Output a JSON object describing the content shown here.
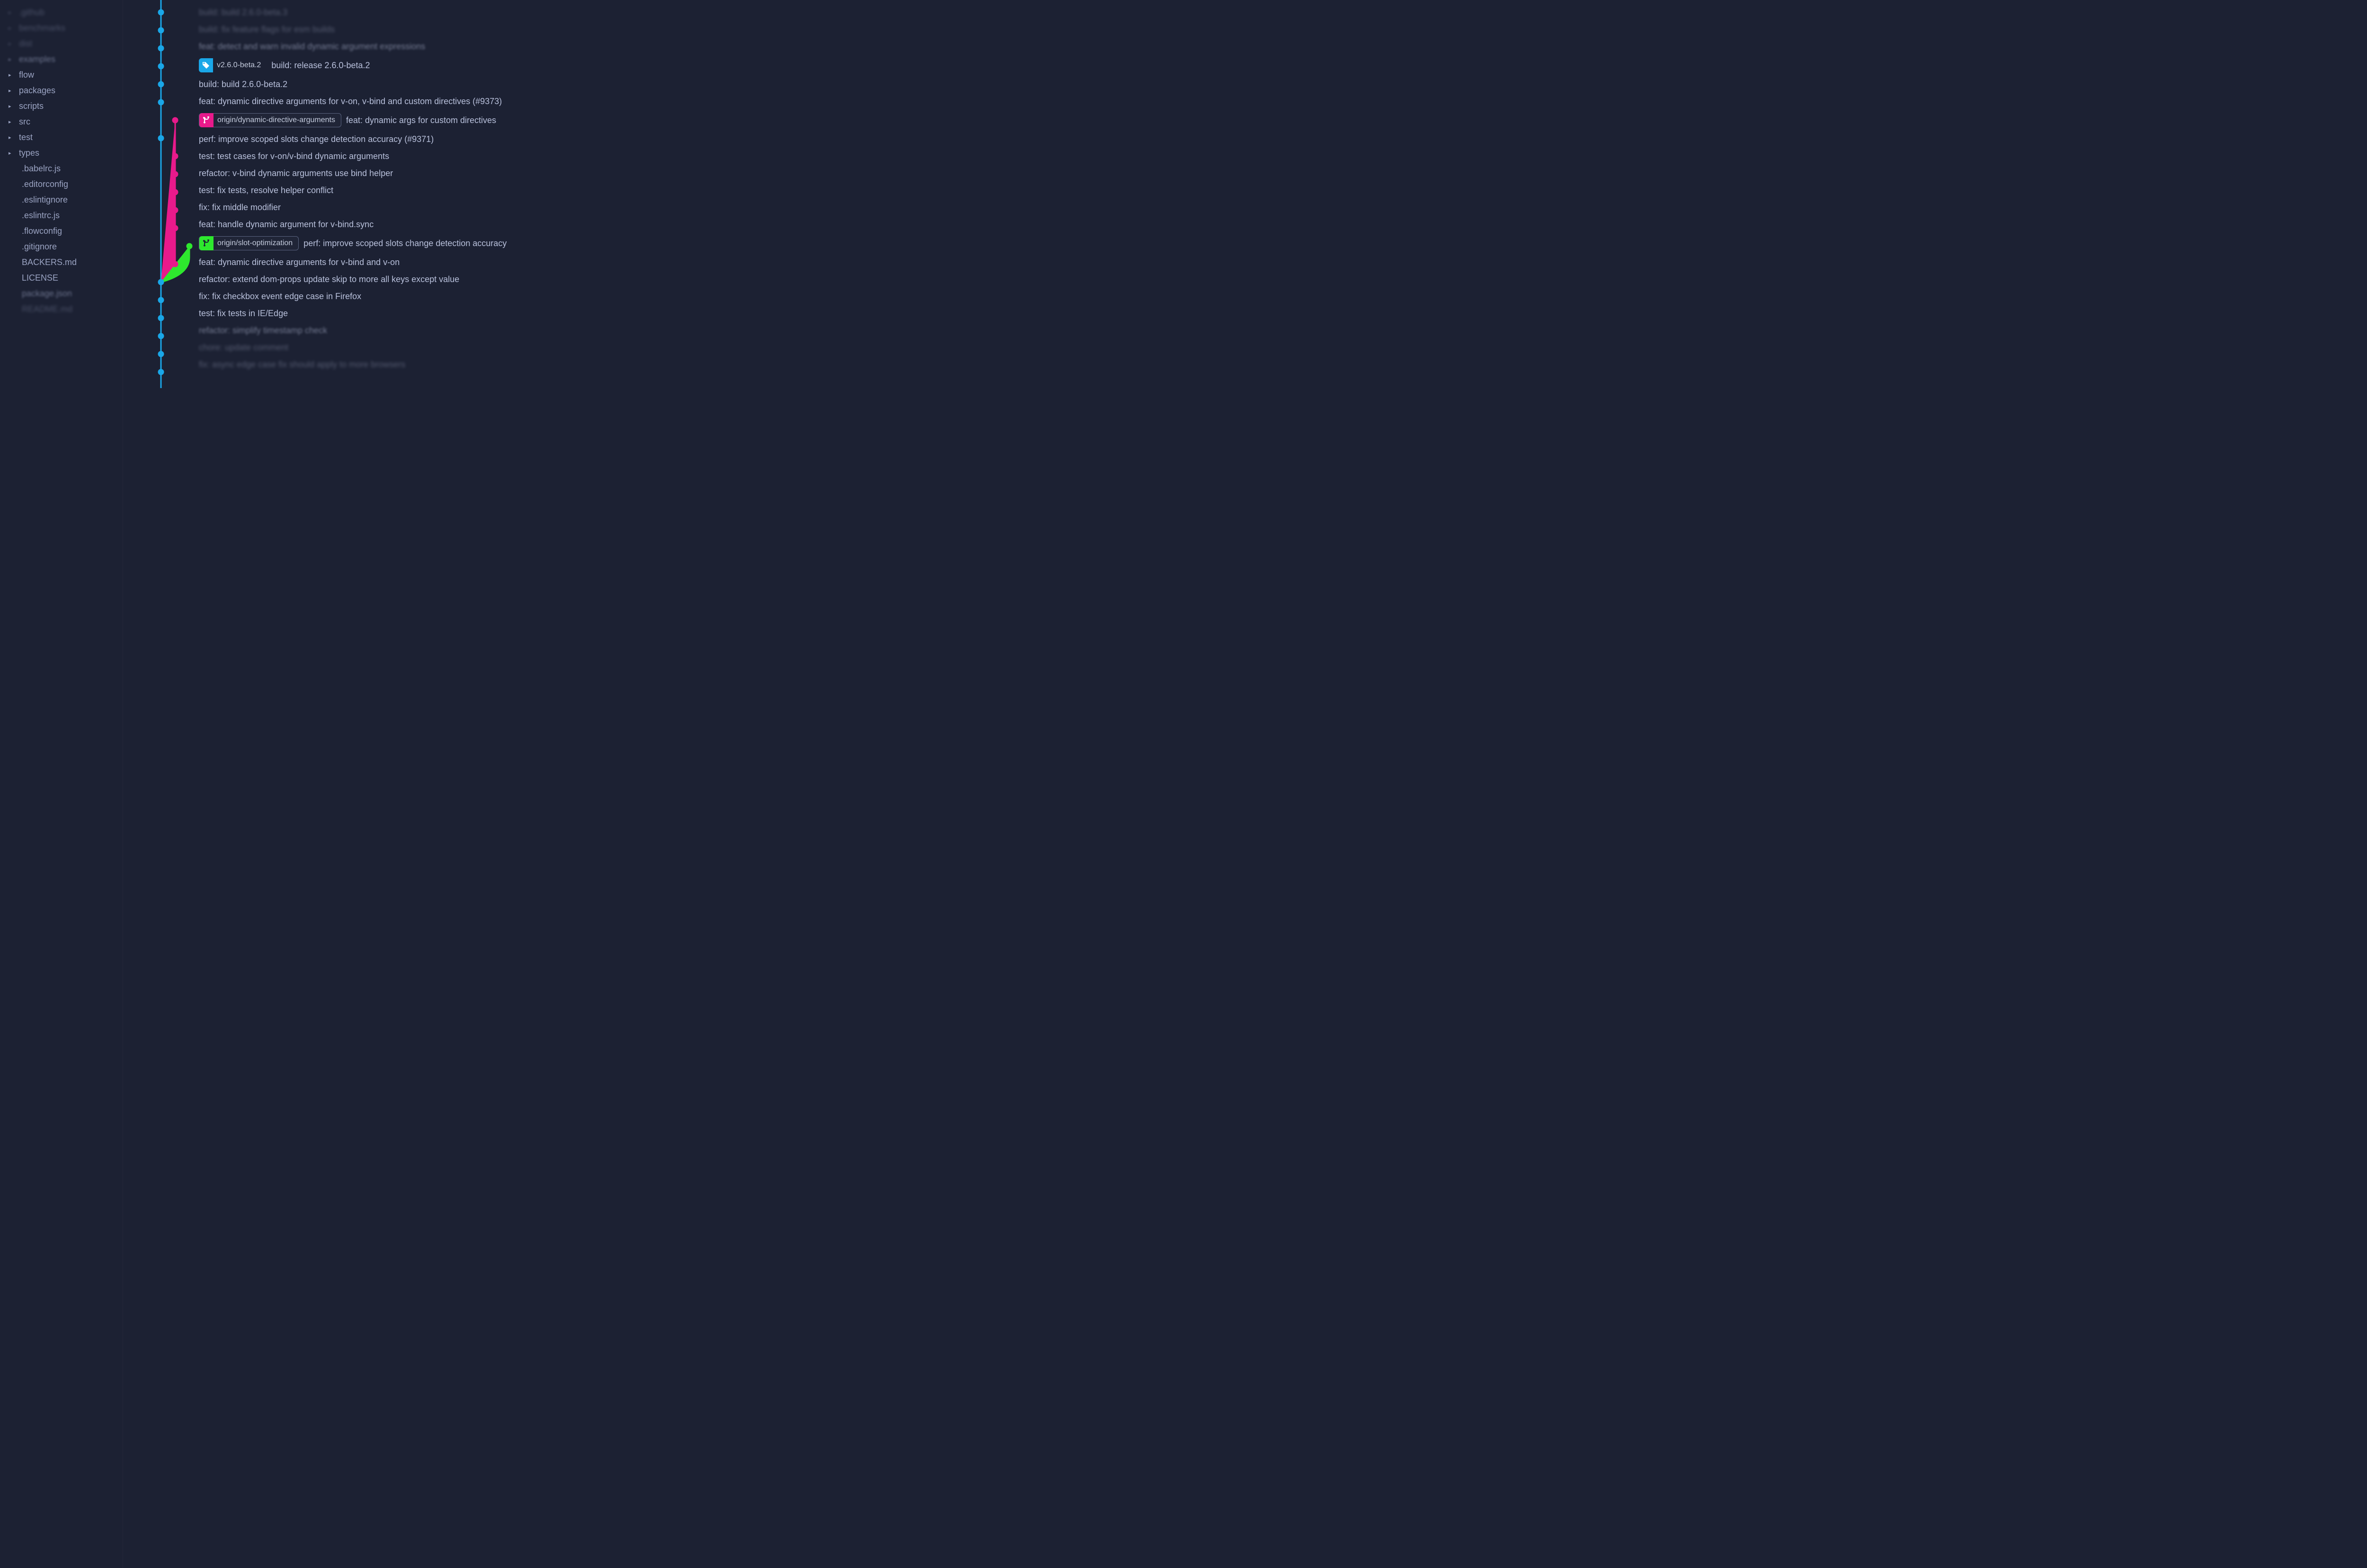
{
  "colors": {
    "bg": "#1c2133",
    "text": "#9aa3c2",
    "blue": "#1aa7e8",
    "pink": "#e81a8b",
    "green": "#2ee82e"
  },
  "sidebar": {
    "items": [
      {
        "label": ".github",
        "kind": "folder",
        "blur": "more"
      },
      {
        "label": "benchmarks",
        "kind": "folder",
        "blur": "more"
      },
      {
        "label": "dist",
        "kind": "folder",
        "blur": "more"
      },
      {
        "label": "examples",
        "kind": "folder",
        "blur": "some"
      },
      {
        "label": "flow",
        "kind": "folder",
        "blur": "none"
      },
      {
        "label": "packages",
        "kind": "folder",
        "blur": "none"
      },
      {
        "label": "scripts",
        "kind": "folder",
        "blur": "none"
      },
      {
        "label": "src",
        "kind": "folder",
        "blur": "none"
      },
      {
        "label": "test",
        "kind": "folder",
        "blur": "none"
      },
      {
        "label": "types",
        "kind": "folder",
        "blur": "none"
      },
      {
        "label": ".babelrc.js",
        "kind": "file",
        "blur": "none"
      },
      {
        "label": ".editorconfig",
        "kind": "file",
        "blur": "none"
      },
      {
        "label": ".eslintignore",
        "kind": "file",
        "blur": "none"
      },
      {
        "label": ".eslintrc.js",
        "kind": "file",
        "blur": "none"
      },
      {
        "label": ".flowconfig",
        "kind": "file",
        "blur": "none"
      },
      {
        "label": ".gitignore",
        "kind": "file",
        "blur": "none"
      },
      {
        "label": "BACKERS.md",
        "kind": "file",
        "blur": "none"
      },
      {
        "label": "LICENSE",
        "kind": "file",
        "blur": "none"
      },
      {
        "label": "package.json",
        "kind": "file",
        "blur": "some"
      },
      {
        "label": "README.md",
        "kind": "file",
        "blur": "more"
      }
    ]
  },
  "commits": [
    {
      "message": "build: build 2.6.0-beta.3",
      "blur": "more",
      "lane": "blue"
    },
    {
      "message": "build: fix feature flags for esm builds",
      "blur": "more",
      "lane": "blue"
    },
    {
      "message": "feat: detect and warn invalid dynamic argument expressions",
      "blur": "some",
      "lane": "blue"
    },
    {
      "message": "build: release 2.6.0-beta.2",
      "tag": "v2.6.0-beta.2",
      "blur": "none",
      "lane": "blue"
    },
    {
      "message": "build: build 2.6.0-beta.2",
      "blur": "none",
      "lane": "blue"
    },
    {
      "message": "feat: dynamic directive arguments for v-on, v-bind and custom directives (#9373)",
      "blur": "none",
      "lane": "blue"
    },
    {
      "message": "feat: dynamic args for custom directives",
      "branch": {
        "name": "origin/dynamic-directive-arguments",
        "color": "pink"
      },
      "blur": "none",
      "lane": "pink"
    },
    {
      "message": "perf: improve scoped slots change detection accuracy (#9371)",
      "blur": "none",
      "lane": "blue"
    },
    {
      "message": "test: test cases for v-on/v-bind dynamic arguments",
      "blur": "none",
      "lane": "pink"
    },
    {
      "message": "refactor: v-bind dynamic arguments use bind helper",
      "blur": "none",
      "lane": "pink"
    },
    {
      "message": "test: fix tests, resolve helper conflict",
      "blur": "none",
      "lane": "pink"
    },
    {
      "message": "fix: fix middle modifier",
      "blur": "none",
      "lane": "pink"
    },
    {
      "message": "feat: handle dynamic argument for v-bind.sync",
      "blur": "none",
      "lane": "pink"
    },
    {
      "message": "perf: improve scoped slots change detection accuracy",
      "branch": {
        "name": "origin/slot-optimization",
        "color": "green"
      },
      "blur": "none",
      "lane": "green"
    },
    {
      "message": "feat: dynamic directive arguments for v-bind and v-on",
      "blur": "none",
      "lane": "pink"
    },
    {
      "message": "refactor: extend dom-props update skip to more all keys except value",
      "blur": "none",
      "lane": "blue"
    },
    {
      "message": "fix: fix checkbox event edge case in Firefox",
      "blur": "none",
      "lane": "blue"
    },
    {
      "message": "test: fix tests in IE/Edge",
      "blur": "none",
      "lane": "blue"
    },
    {
      "message": "refactor: simplify timestamp check",
      "blur": "some",
      "lane": "blue"
    },
    {
      "message": "chore: update comment",
      "blur": "more",
      "lane": "blue"
    },
    {
      "message": "fix: async edge case fix should apply to more browsers",
      "blur": "more",
      "lane": "blue"
    }
  ]
}
